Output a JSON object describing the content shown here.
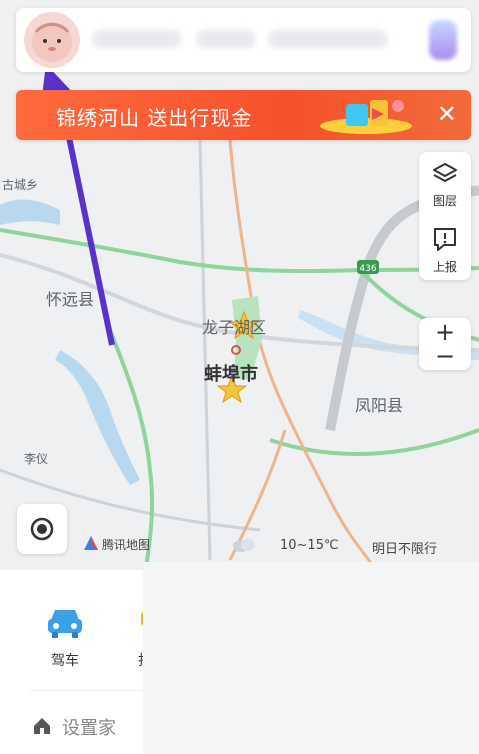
{
  "banner": {
    "text": "锦绣河山  送出行现金",
    "close": "✕"
  },
  "tools": {
    "layers_label": "图层",
    "report_label": "上报",
    "zoom_in": "+",
    "zoom_out": "−"
  },
  "map": {
    "labels": {
      "gucheng": "古城乡",
      "huaiyuan": "怀远县",
      "longzihu": "龙子湖区",
      "bengbu": "蚌埠市",
      "fengyang": "凤阳县",
      "liyi": "李仪",
      "road_shield": "436"
    },
    "attribution": "腾讯地图",
    "weather": "10~15℃",
    "restriction": "明日不限行"
  },
  "bottom": {
    "modes": [
      {
        "label": "驾车",
        "icon": "car-icon"
      },
      {
        "label": "打",
        "icon": "taxi-icon"
      }
    ],
    "home_label": "设置家"
  },
  "colors": {
    "banner": "#f5512c",
    "highway": "#8fd49a",
    "rail": "#f0b48a",
    "arrow": "#5b32c8",
    "car": "#3aa0e8"
  }
}
